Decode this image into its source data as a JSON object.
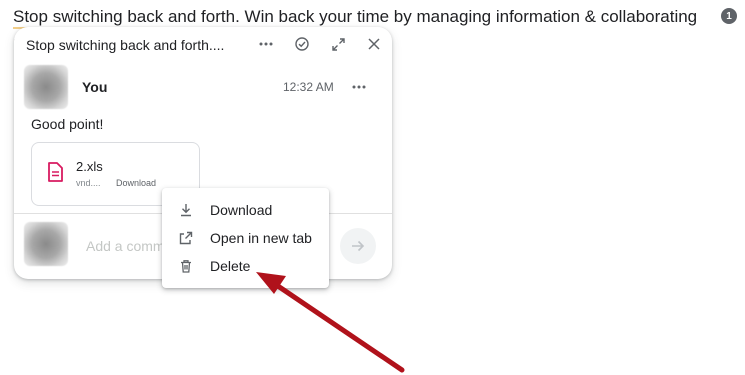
{
  "document": {
    "text_line": "Stop switching back and forth. Win back your time by managing information & collaborating",
    "text_line2": "(",
    "comment_count": "1"
  },
  "panel": {
    "title": "Stop switching back and forth....",
    "comment": {
      "author": "You",
      "time": "12:32 AM",
      "text": "Good point!"
    },
    "attachment": {
      "name": "2.xls",
      "type": "vnd....",
      "download_label": "Download"
    },
    "reply": {
      "placeholder": "Add a comment"
    }
  },
  "context_menu": {
    "items": [
      {
        "label": "Download",
        "icon": "download-icon"
      },
      {
        "label": "Open in new tab",
        "icon": "open-in-new-icon"
      },
      {
        "label": "Delete",
        "icon": "trash-icon"
      }
    ]
  },
  "colors": {
    "file_icon": "#d81b60",
    "annotation_arrow": "#b0121b"
  }
}
